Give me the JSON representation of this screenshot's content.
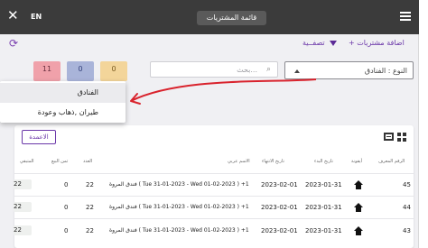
{
  "topbar": {
    "close_icon": "close-icon",
    "lang": "EN",
    "title": "قائمة المشتريات",
    "menu_icon": "menu-icon"
  },
  "toolbar": {
    "refresh_icon": "refresh-icon",
    "filter_label": "تصفــية",
    "filter_icon": "filter-icon",
    "add_label": "+ اضافة مشتريات"
  },
  "badges": [
    {
      "value": "11",
      "color": "#f0a1aa"
    },
    {
      "value": "0",
      "color": "#a9b4d9"
    },
    {
      "value": "0",
      "color": "#f3d59a"
    }
  ],
  "search": {
    "placeholder": "بحث..."
  },
  "type_select": {
    "label": "النوع : الفنادق"
  },
  "dropdown": {
    "options": [
      "الفنادق",
      "طيران ,ذهاب وعودة"
    ]
  },
  "table": {
    "columns_button": "الاعمدة",
    "headers": [
      "الرقم المعرف",
      "أيقونة",
      "تاريخ البدء",
      "تاريخ الانتهاء",
      "الاسم عربي",
      "العدد",
      "ثمن البيع",
      "المتبقي"
    ],
    "rows": [
      {
        "id": "45",
        "start": "2023-01-31",
        "end": "2023-02-01",
        "name": "فندق المروة ( Tue 31-01-2023 - Wed 01-02-2023 ) +1",
        "count": "22",
        "price": "0",
        "remaining": "22"
      },
      {
        "id": "44",
        "start": "2023-01-31",
        "end": "2023-02-01",
        "name": "فندق المروة ( Tue 31-01-2023 - Wed 01-02-2023 ) +1",
        "count": "22",
        "price": "0",
        "remaining": "22"
      },
      {
        "id": "43",
        "start": "2023-01-31",
        "end": "2023-02-01",
        "name": "فندق المروة ( Tue 31-01-2023 - Wed 01-02-2023 ) +1",
        "count": "22",
        "price": "0",
        "remaining": "22"
      }
    ]
  },
  "annotation_color": "#d9232d"
}
